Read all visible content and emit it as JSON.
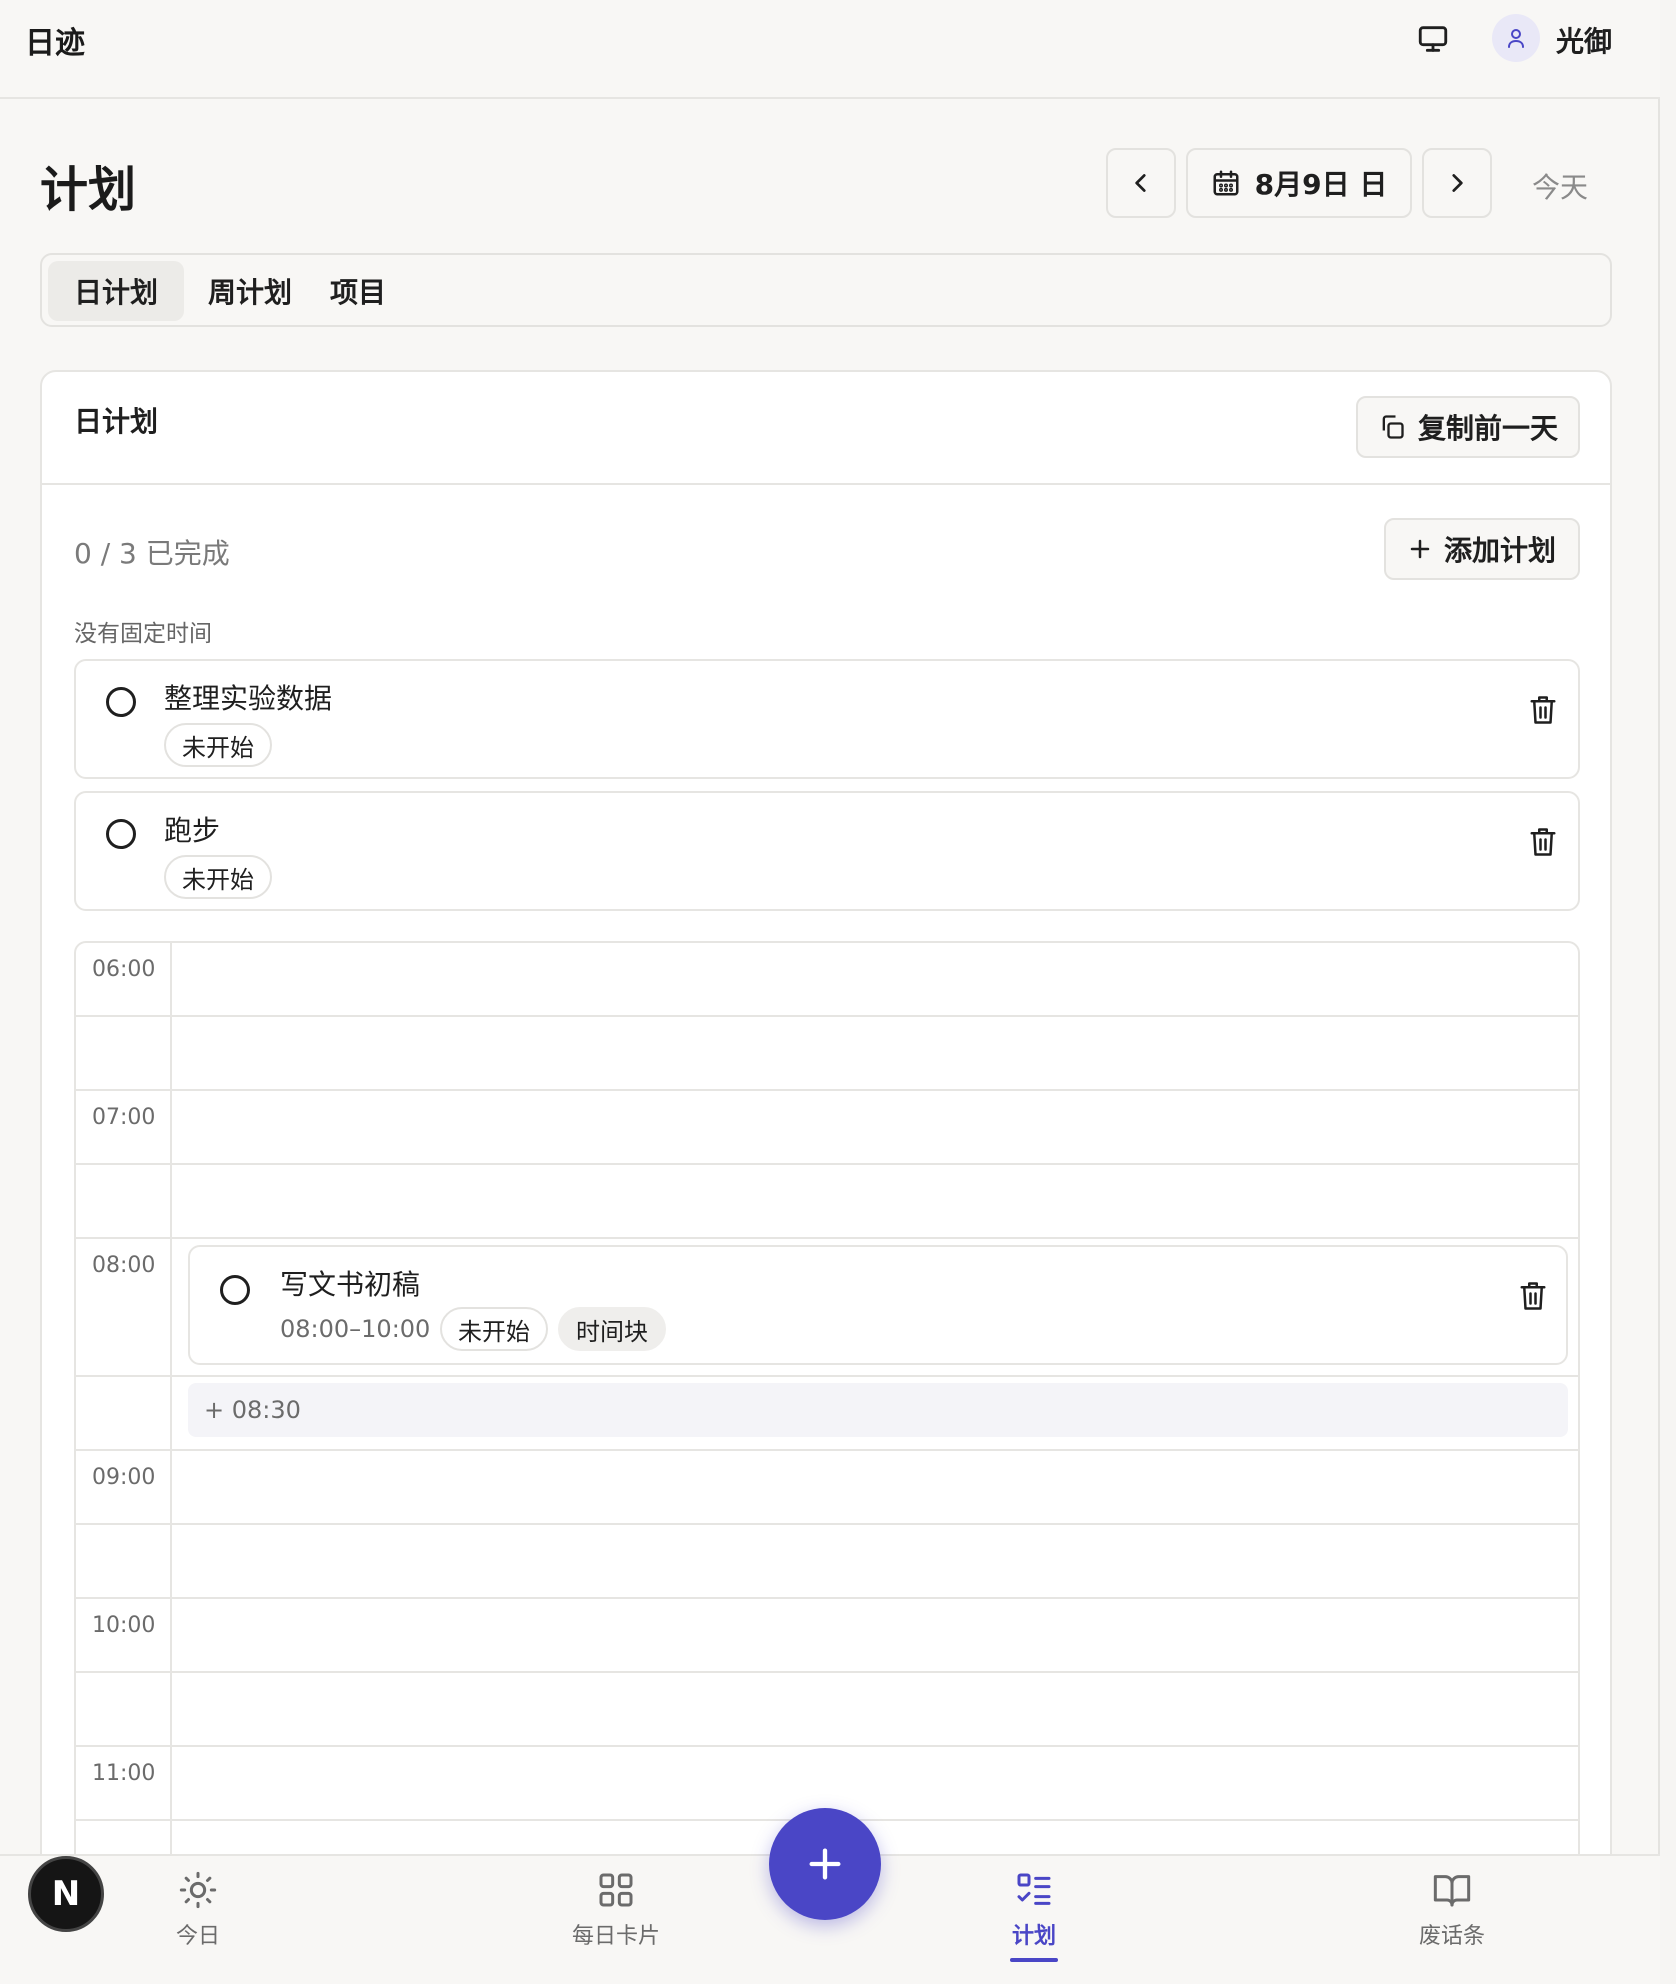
{
  "app": {
    "brand": "日迹",
    "username": "光御"
  },
  "header": {
    "title": "计划",
    "date_label": "8月9日 日",
    "today_label": "今天"
  },
  "tabs": [
    {
      "label": "日计划",
      "active": true
    },
    {
      "label": "周计划",
      "active": false
    },
    {
      "label": "项目",
      "active": false
    }
  ],
  "card": {
    "title": "日计划",
    "copy_label": "复制前一天",
    "progress": "0 / 3 已完成",
    "add_label": "添加计划",
    "section_label": "没有固定时间"
  },
  "untimed_tasks": [
    {
      "title": "整理实验数据",
      "status": "未开始"
    },
    {
      "title": "跑步",
      "status": "未开始"
    }
  ],
  "timeline": {
    "hours": [
      "06:00",
      "07:00",
      "08:00",
      "09:00",
      "10:00",
      "11:00"
    ],
    "event": {
      "title": "写文书初稿",
      "time": "08:00–10:00",
      "status": "未开始",
      "tag": "时间块"
    },
    "quick_add": "+ 08:30"
  },
  "bottom_nav": [
    {
      "label": "今日",
      "icon": "sun-icon"
    },
    {
      "label": "每日卡片",
      "icon": "grid-icon"
    },
    {
      "label": "计划",
      "icon": "checklist-icon",
      "active": true
    },
    {
      "label": "废话条",
      "icon": "book-icon"
    }
  ],
  "badge": "N",
  "colors": {
    "accent": "#4a46c6",
    "background": "#f8f7f5"
  }
}
